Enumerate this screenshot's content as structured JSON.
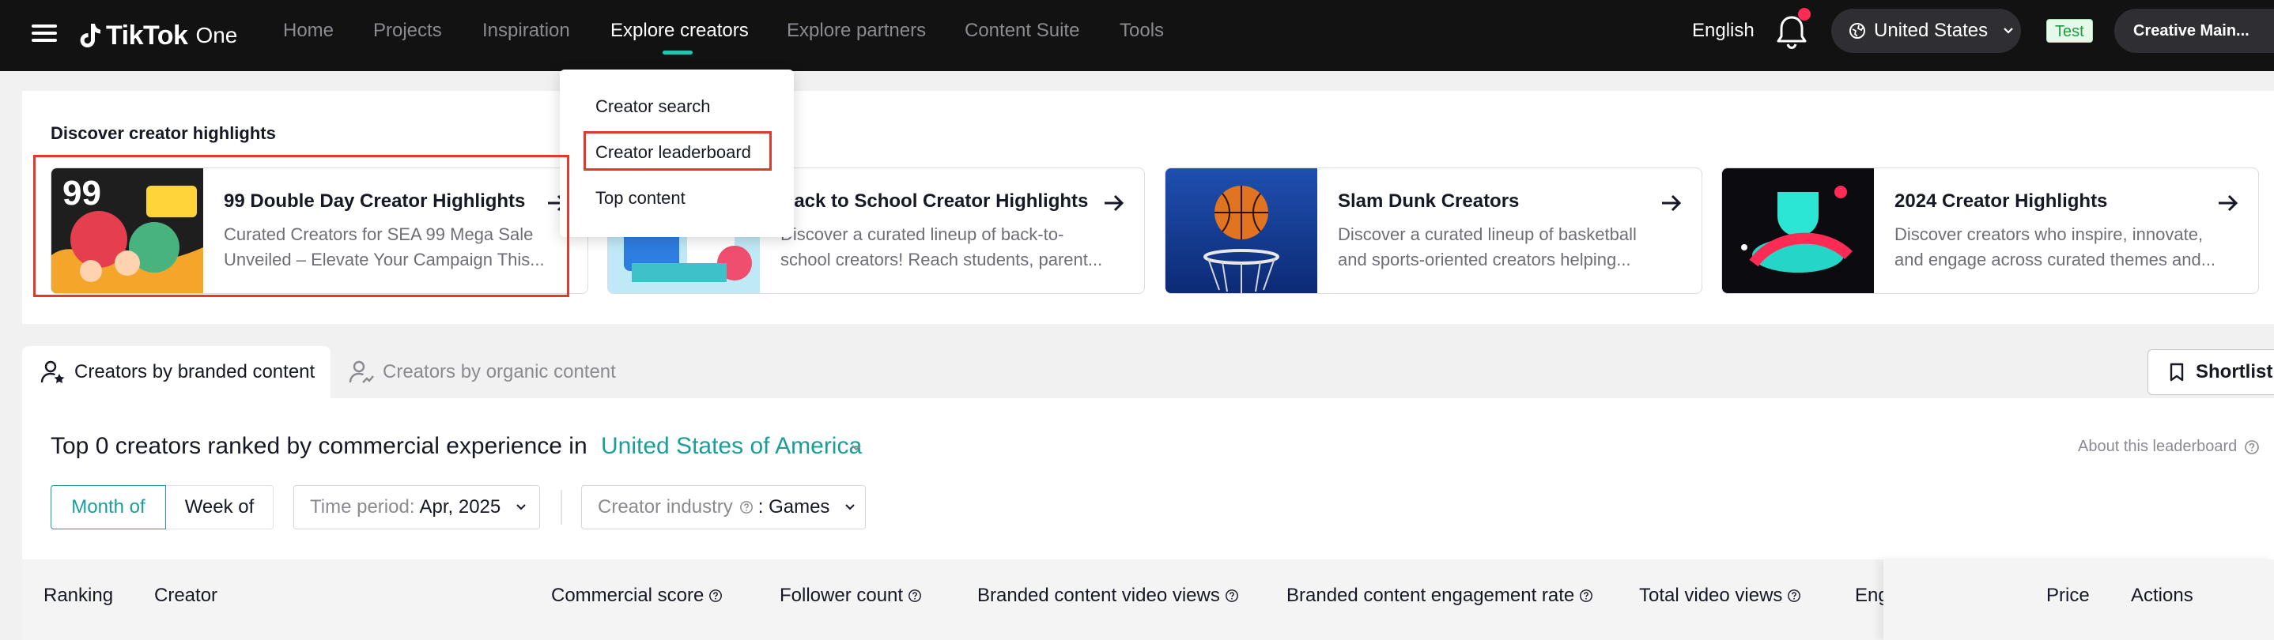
{
  "nav": {
    "brand": "TikTok",
    "brand_sub": "One",
    "items": [
      "Home",
      "Projects",
      "Inspiration",
      "Explore creators",
      "Explore partners",
      "Content Suite",
      "Tools"
    ],
    "language": "English",
    "region": "United States",
    "test_badge": "Test",
    "account": "Creative Main..."
  },
  "dropdown": {
    "items": [
      "Creator search",
      "Creator leaderboard",
      "Top content"
    ]
  },
  "highlights": {
    "title": "Discover creator highlights",
    "cards": [
      {
        "title": "99 Double Day Creator Highlights",
        "desc": "Curated Creators for SEA 99 Mega Sale Unveiled – Elevate Your Campaign This..."
      },
      {
        "title": "Back to School Creator Highlights",
        "desc": "Discover a curated lineup of back-to-school creators! Reach students, parent..."
      },
      {
        "title": "Slam Dunk Creators",
        "desc": "Discover a curated lineup of basketball and sports-oriented creators helping..."
      },
      {
        "title": "2024 Creator Highlights",
        "desc": "Discover creators who inspire, innovate, and engage across curated themes and..."
      }
    ]
  },
  "tabs": {
    "branded": "Creators by branded content",
    "organic": "Creators by organic content",
    "shortlist": "Shortlist"
  },
  "leaderboard": {
    "title": "Top 0 creators ranked by commercial experience in",
    "country": "United States of America",
    "about": "About this leaderboard",
    "month": "Month of",
    "week": "Week of",
    "time_label": "Time period:",
    "time_value": "Apr, 2025",
    "industry_label": "Creator industry",
    "industry_value": ": Games"
  },
  "table": {
    "headers": [
      "Ranking",
      "Creator",
      "Commercial score",
      "Follower count",
      "Branded content video views",
      "Branded content engagement rate",
      "Total video views",
      "Eng",
      "Price",
      "Actions"
    ]
  },
  "colors": {
    "accent": "#1a9e9a",
    "nav_bg": "#121212",
    "highlight_red": "#e03a2f"
  }
}
